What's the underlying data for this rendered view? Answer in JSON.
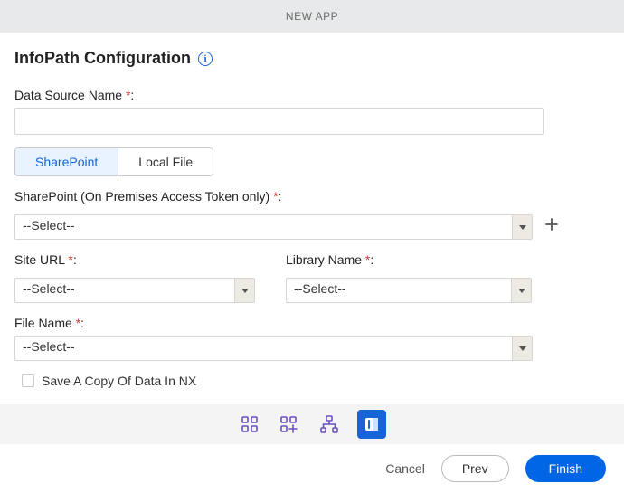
{
  "header": {
    "title": "NEW APP"
  },
  "page": {
    "title": "InfoPath Configuration"
  },
  "fields": {
    "dataSourceName": {
      "label": "Data Source Name ",
      "value": ""
    },
    "tabs": {
      "sharepoint": "SharePoint",
      "localFile": "Local File"
    },
    "sharepoint": {
      "label": "SharePoint (On Premises Access Token only) ",
      "value": "--Select--"
    },
    "siteUrl": {
      "label": "Site URL ",
      "value": "--Select--"
    },
    "libraryName": {
      "label": "Library Name ",
      "value": "--Select--"
    },
    "fileName": {
      "label": "File Name ",
      "value": "--Select--"
    },
    "saveCopy": {
      "label": "Save A Copy Of Data In NX"
    }
  },
  "buttons": {
    "cancel": "Cancel",
    "prev": "Prev",
    "finish": "Finish"
  },
  "punct": {
    "colon": ":",
    "star": "*"
  }
}
